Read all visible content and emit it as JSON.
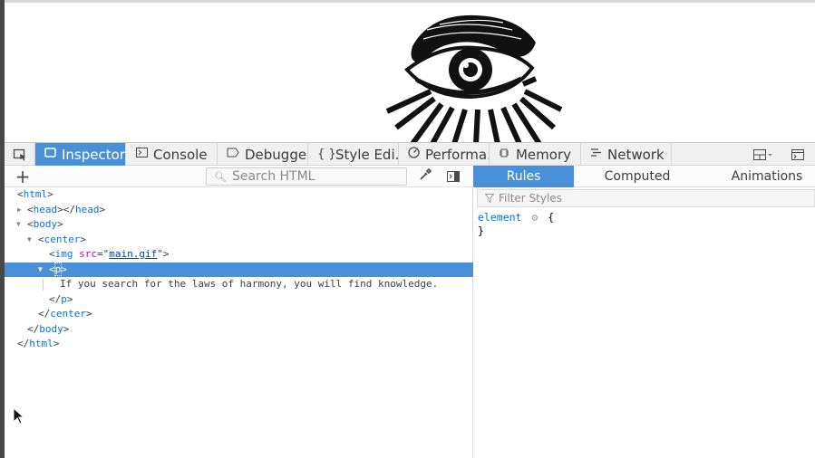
{
  "devtools": {
    "tabs": [
      {
        "label": "Inspector",
        "icon": "inspector-box-icon",
        "active": true
      },
      {
        "label": "Console",
        "icon": "console-icon"
      },
      {
        "label": "Debugger",
        "icon": "debugger-icon"
      },
      {
        "label": "Style Edi...",
        "icon": "braces-icon"
      },
      {
        "label": "Performa...",
        "icon": "performance-gauge-icon"
      },
      {
        "label": "Memory",
        "icon": "memory-chip-icon"
      },
      {
        "label": "Network",
        "icon": "network-icon"
      }
    ],
    "search_placeholder": "Search HTML",
    "markup": {
      "html_open": "html",
      "head": "head",
      "body": "body",
      "center": "center",
      "img_tag": "img",
      "img_attr": "src",
      "img_value": "main.gif",
      "p_tag": "p",
      "text": "If you search for the laws of harmony, you will find knowledge."
    },
    "sidebar": {
      "tabs": [
        "Rules",
        "Computed",
        "Animations"
      ],
      "active_tab": "Rules",
      "filter_placeholder": "Filter Styles",
      "rule_selector": "element",
      "open_brace": "{",
      "close_brace": "}"
    }
  },
  "colors": {
    "accent": "#4a90d9",
    "tag": "#0074e8",
    "attr": "#dd00a9"
  }
}
